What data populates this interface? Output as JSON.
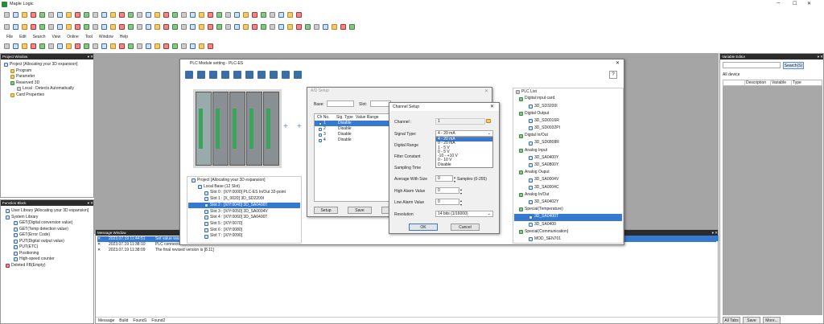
{
  "app": {
    "title": "Maple Logic",
    "win_min": "─",
    "win_max": "☐",
    "win_close": "✕"
  },
  "menu": [
    "File",
    "Edit",
    "Search",
    "View",
    "Online",
    "Tool",
    "Window",
    "Help"
  ],
  "project_window": {
    "title": "Project Window",
    "tree": [
      "Project [Allocating your 3D expansion]",
      "Program",
      "Parameter",
      "Reserved 3D",
      "Local : Detects Automatically",
      "Card Properties"
    ]
  },
  "function_block": {
    "title": "Function Block",
    "tree": [
      "User Library [Allocating your 3D expansion]",
      "System Library",
      "GET(Digital conversion value)",
      "GET(Temp detection value)",
      "GET(Error Code)",
      "PUT(Digital output value)",
      "PUT(ETC)",
      "Positioning",
      "High-speed counter",
      "Deleted FB(Empty)"
    ]
  },
  "variable_editor": {
    "title": "Variable Editor",
    "search_label": "Search(S)",
    "all_device": "All device",
    "cols": [
      "Description",
      "Variable",
      "Type"
    ],
    "tabs": [
      "All Tabs",
      "Save",
      "More..."
    ]
  },
  "plc_module": {
    "title": "PLC Module setting - PLC-ES",
    "help": "?",
    "tree": [
      "Project [Allocating your 3D expansion]",
      "Local Base (12 Slot)",
      "Slot 0 : [X/Y:0000] PLC-ES In/Out 32-point",
      "Slot 1 : [X_0020] 3D_SD2200I",
      "Slot 2 : [X/Y:0040] 3D_SA0400T",
      "Slot 3 : [X/Y:0050] 3D_SA0004V",
      "Slot 4 : [X/Y:0060] 3D_SA0400T",
      "Slot 5 : [X/Y:0070]",
      "Slot 6 : [X/Y:0080]",
      "Slot 7 : [X/Y:0090]"
    ],
    "plc_list_title": "PLC List",
    "plc_list": [
      {
        "t": "Digital input card",
        "lvl": 1
      },
      {
        "t": "3D_SD3200I",
        "lvl": 2
      },
      {
        "t": "Digital Output",
        "lvl": 1
      },
      {
        "t": "3D_SD0016R",
        "lvl": 2
      },
      {
        "t": "3D_SD0032PI",
        "lvl": 2
      },
      {
        "t": "Digital In/Out",
        "lvl": 1
      },
      {
        "t": "3D_SD0808R",
        "lvl": 2
      },
      {
        "t": "Analog Input",
        "lvl": 1
      },
      {
        "t": "3D_SA0400Y",
        "lvl": 2
      },
      {
        "t": "3D_SA0800Y",
        "lvl": 2
      },
      {
        "t": "Analog Ouput",
        "lvl": 1
      },
      {
        "t": "3D_SA0004V",
        "lvl": 2
      },
      {
        "t": "3D_SA0004C",
        "lvl": 2
      },
      {
        "t": "Analog In/Out",
        "lvl": 1
      },
      {
        "t": "3D_SA0402Y",
        "lvl": 2
      },
      {
        "t": "Special(Temperature)",
        "lvl": 1
      },
      {
        "t": "3D_SA0400T",
        "lvl": 2,
        "sel": true
      },
      {
        "t": "3D_SA0400",
        "lvl": 2
      },
      {
        "t": "Special(Communication)",
        "lvl": 1
      },
      {
        "t": "MOD_SEN701",
        "lvl": 2
      }
    ]
  },
  "ad_setup": {
    "title": "A/D Setup",
    "base_label": "Base:",
    "slot_label": "Slot:",
    "cols": [
      "Ch No.",
      "Sig. Type",
      "Value Range"
    ],
    "rows": [
      [
        "1",
        "Disable"
      ],
      [
        "2",
        "Disable"
      ],
      [
        "3",
        "Disable"
      ],
      [
        "4",
        "Disable"
      ]
    ],
    "buttons": [
      "Setup",
      "Save",
      "Close"
    ]
  },
  "channel_setup": {
    "title": "Channel Setup",
    "channel_label": "Channel :",
    "channel_value": "1",
    "signal_label": "Signal Type:",
    "signal_value": "4 - 20 mA",
    "signal_options": [
      "4 - 20 mA",
      "0 - 20 mA",
      "1 - 5 V",
      "0 - 5 V",
      "-10 - +10 V",
      "0 - 10 V",
      "Disable"
    ],
    "digital_range_label": "Digital Range",
    "filter_label": "Filter Constant",
    "sampling_label": "Sampling Time",
    "average_label": "Average With Size",
    "average_value": "0",
    "samples_label": "Samples (0-255)",
    "high_alarm_label": "High Alarm Value",
    "high_alarm_value": "0",
    "low_alarm_label": "Low Alarm Value",
    "low_alarm_value": "0",
    "resolution_label": "Resolution",
    "resolution_value": "14 bits (1/16000)",
    "ok": "OK",
    "cancel": "Cancel"
  },
  "message_window": {
    "title": "Message Window",
    "rows": [
      {
        "time": "2023.07.19 11:44:51",
        "msg": "Set value was...",
        "sel": true
      },
      {
        "time": "2023.07.19 11:38:10",
        "msg": "PLC connection mode = usw >"
      },
      {
        "time": "2023.07.19 11:38:09",
        "msg": "The final revised version is [8.11]"
      }
    ],
    "tabs": [
      "Message",
      "Build",
      "Found1",
      "Found2"
    ]
  }
}
